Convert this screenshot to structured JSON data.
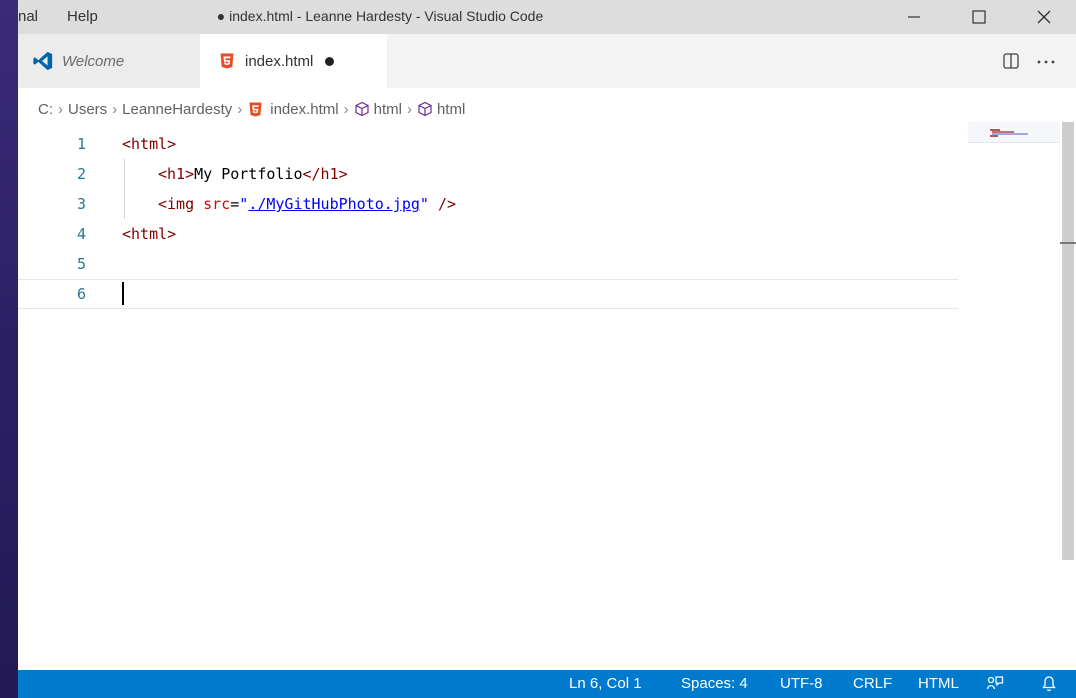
{
  "menu": {
    "terminal": "nal",
    "help": "Help"
  },
  "window": {
    "title": "● index.html - Leanne Hardesty - Visual Studio Code"
  },
  "tabs": [
    {
      "label": "Welcome",
      "icon": "vscode-logo-icon"
    },
    {
      "label": "index.html",
      "icon": "html5-icon",
      "dirty": true
    }
  ],
  "breadcrumb": {
    "drive": "C:",
    "folder1": "Users",
    "folder2": "LeanneHardesty",
    "file": "index.html",
    "sym1": "html",
    "sym2": "html"
  },
  "editor": {
    "line_numbers": [
      "1",
      "2",
      "3",
      "4",
      "5",
      "6"
    ],
    "code": {
      "l1_tag": "<html>",
      "l2_open": "<h1>",
      "l2_text": "My Portfolio",
      "l2_close": "</h1>",
      "l3_tag": "<img",
      "l3_attr": "src",
      "l3_eq": "=",
      "l3_q1": "\"",
      "l3_link": "./MyGitHubPhoto.jpg",
      "l3_q2": "\"",
      "l3_end": "/>",
      "l4_tag": "<html>"
    }
  },
  "statusbar": {
    "position": "Ln 6, Col 1",
    "spaces": "Spaces: 4",
    "encoding": "UTF-8",
    "eol": "CRLF",
    "language": "HTML"
  },
  "colors": {
    "statusbar": "#007acc",
    "tag": "#800000",
    "attr": "#e50000",
    "string": "#0000ff",
    "line_number": "#237893",
    "html5": "#e44d26"
  }
}
